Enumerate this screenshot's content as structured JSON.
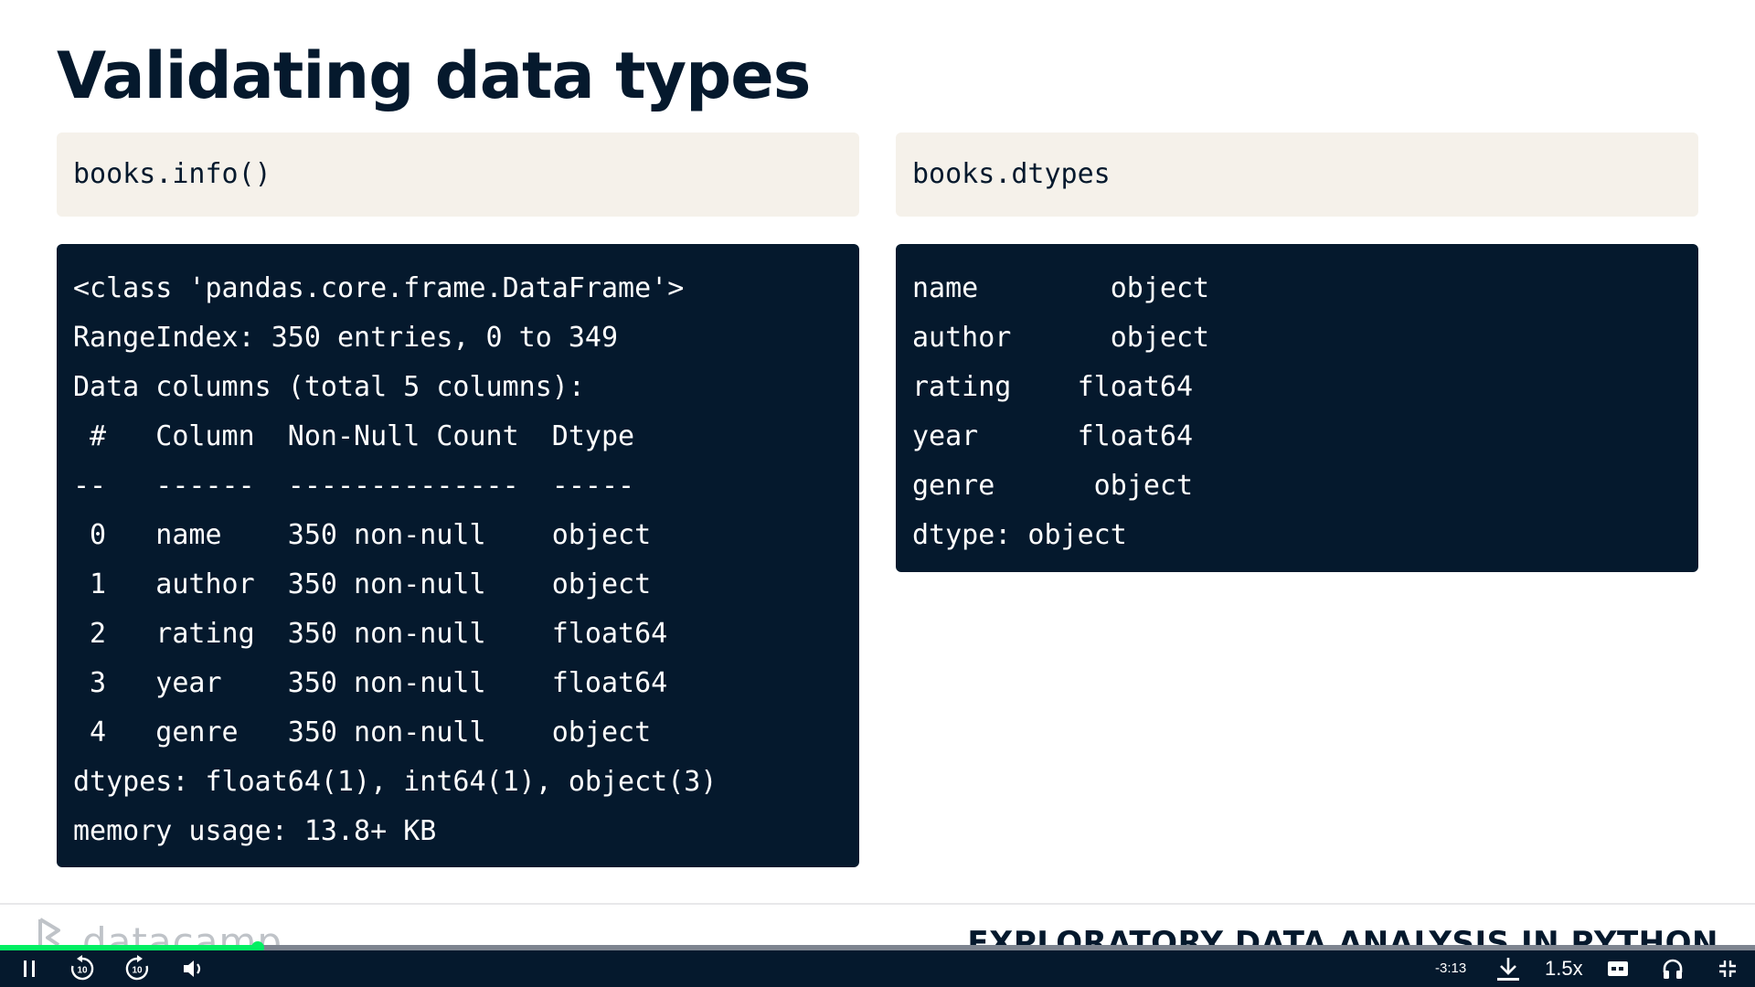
{
  "slide": {
    "title": "Validating data types",
    "left_panel": {
      "code_input": "books.info()",
      "output_lines": [
        "<class 'pandas.core.frame.DataFrame'>",
        "RangeIndex: 350 entries, 0 to 349",
        "Data columns (total 5 columns):",
        " #   Column  Non-Null Count  Dtype",
        "--   ------  --------------  -----",
        " 0   name    350 non-null    object",
        " 1   author  350 non-null    object",
        " 2   rating  350 non-null    float64",
        " 3   year    350 non-null    float64",
        " 4   genre   350 non-null    object",
        "dtypes: float64(1), int64(1), object(3)",
        "memory usage: 13.8+ KB"
      ]
    },
    "right_panel": {
      "code_input": "books.dtypes",
      "output_lines": [
        "name        object",
        "author      object",
        "rating    float64",
        "year      float64",
        "genre      object",
        "dtype: object"
      ]
    }
  },
  "footer": {
    "brand_name": "datacamp",
    "course_title": "EXPLORATORY DATA ANALYSIS IN PYTHON"
  },
  "player": {
    "progress_fraction": 0.147,
    "time_remaining": "-3:13",
    "playback_speed": "1.5x",
    "skip_back_seconds": "10",
    "skip_forward_seconds": "10",
    "icons": {
      "pause": "pause-icon",
      "rewind": "rewind-10-icon",
      "forward": "forward-10-icon",
      "volume": "volume-icon",
      "download": "download-icon",
      "captions": "captions-icon",
      "audio": "headphones-icon",
      "fullscreen": "exit-fullscreen-icon"
    },
    "colors": {
      "progress": "#03ef62",
      "bar_background": "#05192d"
    }
  }
}
